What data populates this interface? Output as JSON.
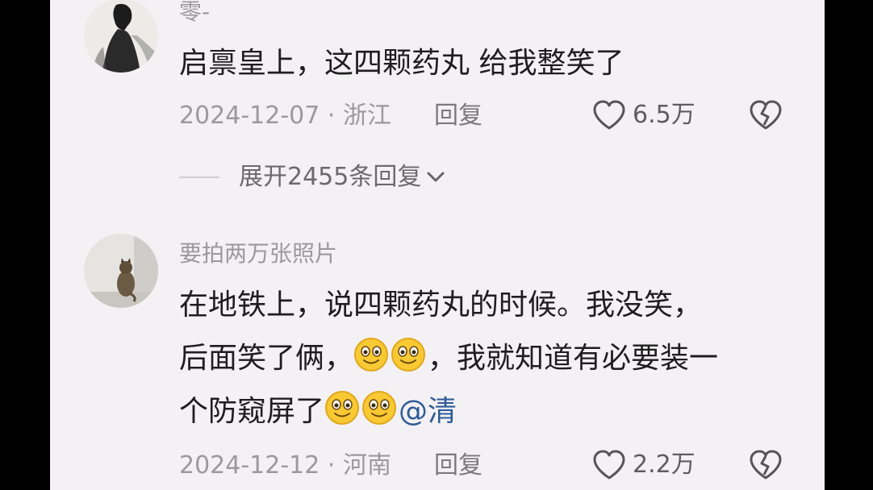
{
  "comments": [
    {
      "username": "零-",
      "avatar": "ink-painting-woman-avatar",
      "text": "启禀皇上，这四颗药丸 给我整笑了",
      "date": "2024-12-07",
      "location": "浙江",
      "reply_label": "回复",
      "likes": "6.5万",
      "expand_label": "展开2455条回复"
    },
    {
      "username": "要拍两万张照片",
      "avatar": "cat-photo-avatar",
      "line1": "在地铁上，说四颗药丸的时候。我没笑，",
      "line2_a": "后面笑了俩，",
      "line2_b": "，我就知道有必要装一",
      "line3": "个防窥屏了",
      "mention": "@清",
      "date": "2024-12-12",
      "location": "河南",
      "reply_label": "回复",
      "likes": "2.2万"
    }
  ],
  "meta_separator": "·",
  "icons": {
    "like": "heart-outline-icon",
    "dislike": "broken-heart-icon",
    "expand": "chevron-down-icon",
    "emoji": "smiling-face-emoji"
  },
  "colors": {
    "background": "#f4f1f4",
    "text": "#1e1e1e",
    "muted": "#9a9a9a",
    "mention": "#2f5c98",
    "letterbox": "#000000"
  }
}
